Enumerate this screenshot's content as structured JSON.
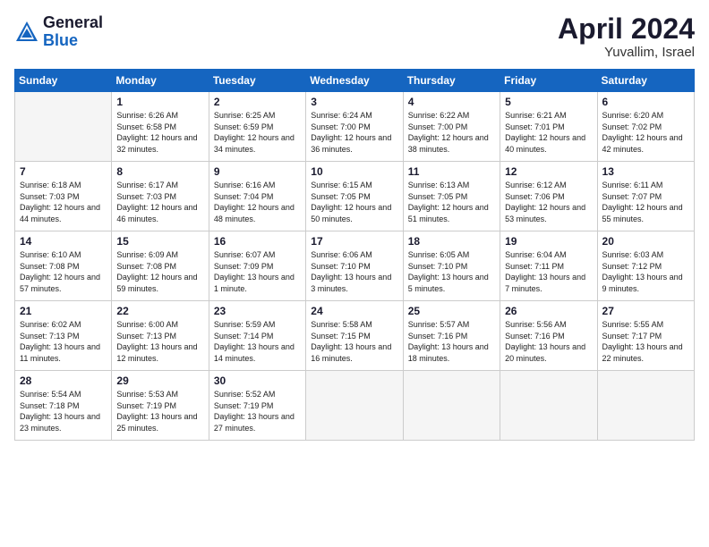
{
  "header": {
    "logo_general": "General",
    "logo_blue": "Blue",
    "month_title": "April 2024",
    "location": "Yuvallim, Israel"
  },
  "days_of_week": [
    "Sunday",
    "Monday",
    "Tuesday",
    "Wednesday",
    "Thursday",
    "Friday",
    "Saturday"
  ],
  "weeks": [
    [
      {
        "day": "",
        "sunrise": "",
        "sunset": "",
        "daylight": ""
      },
      {
        "day": "1",
        "sunrise": "Sunrise: 6:26 AM",
        "sunset": "Sunset: 6:58 PM",
        "daylight": "Daylight: 12 hours and 32 minutes."
      },
      {
        "day": "2",
        "sunrise": "Sunrise: 6:25 AM",
        "sunset": "Sunset: 6:59 PM",
        "daylight": "Daylight: 12 hours and 34 minutes."
      },
      {
        "day": "3",
        "sunrise": "Sunrise: 6:24 AM",
        "sunset": "Sunset: 7:00 PM",
        "daylight": "Daylight: 12 hours and 36 minutes."
      },
      {
        "day": "4",
        "sunrise": "Sunrise: 6:22 AM",
        "sunset": "Sunset: 7:00 PM",
        "daylight": "Daylight: 12 hours and 38 minutes."
      },
      {
        "day": "5",
        "sunrise": "Sunrise: 6:21 AM",
        "sunset": "Sunset: 7:01 PM",
        "daylight": "Daylight: 12 hours and 40 minutes."
      },
      {
        "day": "6",
        "sunrise": "Sunrise: 6:20 AM",
        "sunset": "Sunset: 7:02 PM",
        "daylight": "Daylight: 12 hours and 42 minutes."
      }
    ],
    [
      {
        "day": "7",
        "sunrise": "Sunrise: 6:18 AM",
        "sunset": "Sunset: 7:03 PM",
        "daylight": "Daylight: 12 hours and 44 minutes."
      },
      {
        "day": "8",
        "sunrise": "Sunrise: 6:17 AM",
        "sunset": "Sunset: 7:03 PM",
        "daylight": "Daylight: 12 hours and 46 minutes."
      },
      {
        "day": "9",
        "sunrise": "Sunrise: 6:16 AM",
        "sunset": "Sunset: 7:04 PM",
        "daylight": "Daylight: 12 hours and 48 minutes."
      },
      {
        "day": "10",
        "sunrise": "Sunrise: 6:15 AM",
        "sunset": "Sunset: 7:05 PM",
        "daylight": "Daylight: 12 hours and 50 minutes."
      },
      {
        "day": "11",
        "sunrise": "Sunrise: 6:13 AM",
        "sunset": "Sunset: 7:05 PM",
        "daylight": "Daylight: 12 hours and 51 minutes."
      },
      {
        "day": "12",
        "sunrise": "Sunrise: 6:12 AM",
        "sunset": "Sunset: 7:06 PM",
        "daylight": "Daylight: 12 hours and 53 minutes."
      },
      {
        "day": "13",
        "sunrise": "Sunrise: 6:11 AM",
        "sunset": "Sunset: 7:07 PM",
        "daylight": "Daylight: 12 hours and 55 minutes."
      }
    ],
    [
      {
        "day": "14",
        "sunrise": "Sunrise: 6:10 AM",
        "sunset": "Sunset: 7:08 PM",
        "daylight": "Daylight: 12 hours and 57 minutes."
      },
      {
        "day": "15",
        "sunrise": "Sunrise: 6:09 AM",
        "sunset": "Sunset: 7:08 PM",
        "daylight": "Daylight: 12 hours and 59 minutes."
      },
      {
        "day": "16",
        "sunrise": "Sunrise: 6:07 AM",
        "sunset": "Sunset: 7:09 PM",
        "daylight": "Daylight: 13 hours and 1 minute."
      },
      {
        "day": "17",
        "sunrise": "Sunrise: 6:06 AM",
        "sunset": "Sunset: 7:10 PM",
        "daylight": "Daylight: 13 hours and 3 minutes."
      },
      {
        "day": "18",
        "sunrise": "Sunrise: 6:05 AM",
        "sunset": "Sunset: 7:10 PM",
        "daylight": "Daylight: 13 hours and 5 minutes."
      },
      {
        "day": "19",
        "sunrise": "Sunrise: 6:04 AM",
        "sunset": "Sunset: 7:11 PM",
        "daylight": "Daylight: 13 hours and 7 minutes."
      },
      {
        "day": "20",
        "sunrise": "Sunrise: 6:03 AM",
        "sunset": "Sunset: 7:12 PM",
        "daylight": "Daylight: 13 hours and 9 minutes."
      }
    ],
    [
      {
        "day": "21",
        "sunrise": "Sunrise: 6:02 AM",
        "sunset": "Sunset: 7:13 PM",
        "daylight": "Daylight: 13 hours and 11 minutes."
      },
      {
        "day": "22",
        "sunrise": "Sunrise: 6:00 AM",
        "sunset": "Sunset: 7:13 PM",
        "daylight": "Daylight: 13 hours and 12 minutes."
      },
      {
        "day": "23",
        "sunrise": "Sunrise: 5:59 AM",
        "sunset": "Sunset: 7:14 PM",
        "daylight": "Daylight: 13 hours and 14 minutes."
      },
      {
        "day": "24",
        "sunrise": "Sunrise: 5:58 AM",
        "sunset": "Sunset: 7:15 PM",
        "daylight": "Daylight: 13 hours and 16 minutes."
      },
      {
        "day": "25",
        "sunrise": "Sunrise: 5:57 AM",
        "sunset": "Sunset: 7:16 PM",
        "daylight": "Daylight: 13 hours and 18 minutes."
      },
      {
        "day": "26",
        "sunrise": "Sunrise: 5:56 AM",
        "sunset": "Sunset: 7:16 PM",
        "daylight": "Daylight: 13 hours and 20 minutes."
      },
      {
        "day": "27",
        "sunrise": "Sunrise: 5:55 AM",
        "sunset": "Sunset: 7:17 PM",
        "daylight": "Daylight: 13 hours and 22 minutes."
      }
    ],
    [
      {
        "day": "28",
        "sunrise": "Sunrise: 5:54 AM",
        "sunset": "Sunset: 7:18 PM",
        "daylight": "Daylight: 13 hours and 23 minutes."
      },
      {
        "day": "29",
        "sunrise": "Sunrise: 5:53 AM",
        "sunset": "Sunset: 7:19 PM",
        "daylight": "Daylight: 13 hours and 25 minutes."
      },
      {
        "day": "30",
        "sunrise": "Sunrise: 5:52 AM",
        "sunset": "Sunset: 7:19 PM",
        "daylight": "Daylight: 13 hours and 27 minutes."
      },
      {
        "day": "",
        "sunrise": "",
        "sunset": "",
        "daylight": ""
      },
      {
        "day": "",
        "sunrise": "",
        "sunset": "",
        "daylight": ""
      },
      {
        "day": "",
        "sunrise": "",
        "sunset": "",
        "daylight": ""
      },
      {
        "day": "",
        "sunrise": "",
        "sunset": "",
        "daylight": ""
      }
    ]
  ]
}
